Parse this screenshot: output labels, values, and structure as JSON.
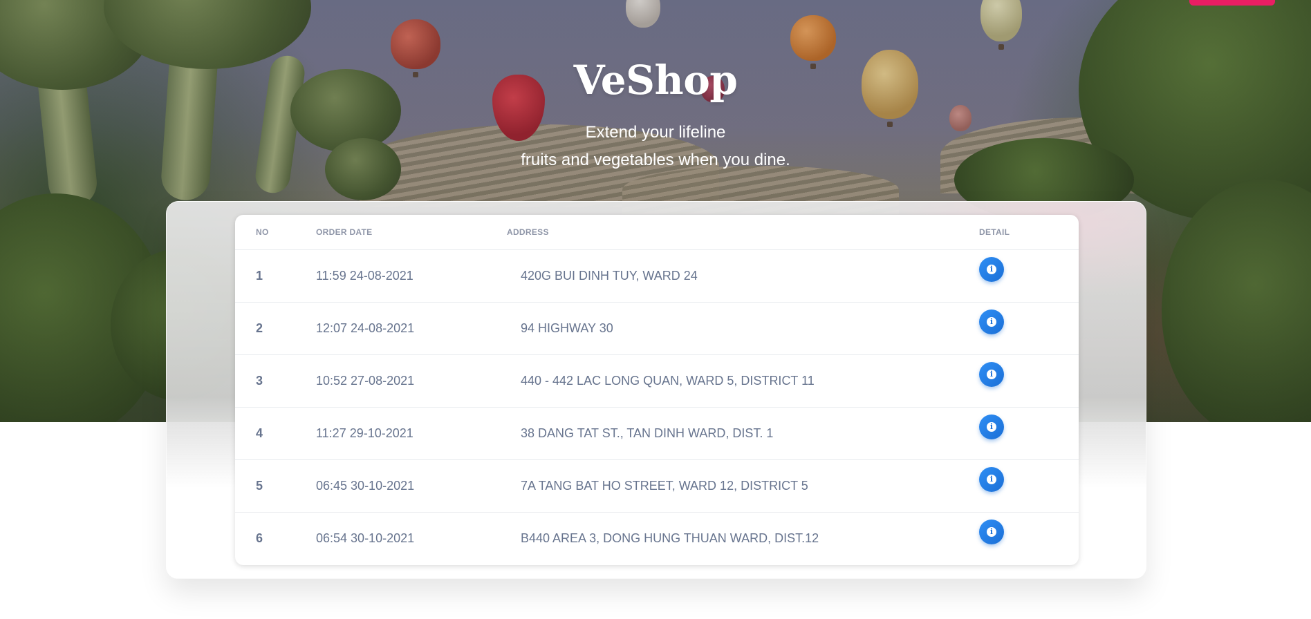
{
  "app": {
    "title": "VeShop",
    "subtitle_line1": "Extend your lifeline",
    "subtitle_line2": "fruits and vegetables when you dine."
  },
  "colors": {
    "accent": "#e91e63",
    "detail_button": "#1b6fd6",
    "table_text": "#67748e",
    "header_text": "#8f96a8"
  },
  "table": {
    "headers": {
      "no": "NO",
      "order_date": "ORDER DATE",
      "address": "ADDRESS",
      "detail": "DETAIL"
    },
    "detail_icon": "info-icon",
    "rows": [
      {
        "no": "1",
        "order_date": "11:59 24-08-2021",
        "address": "420G BUI DINH TUY, WARD 24"
      },
      {
        "no": "2",
        "order_date": "12:07 24-08-2021",
        "address": "94 HIGHWAY 30"
      },
      {
        "no": "3",
        "order_date": "10:52 27-08-2021",
        "address": "440 - 442 LAC LONG QUAN, WARD 5, DISTRICT 11"
      },
      {
        "no": "4",
        "order_date": "11:27 29-10-2021",
        "address": "38 DANG TAT ST., TAN DINH WARD, DIST. 1"
      },
      {
        "no": "5",
        "order_date": "06:45 30-10-2021",
        "address": "7A TANG BAT HO STREET, WARD 12, DISTRICT 5"
      },
      {
        "no": "6",
        "order_date": "06:54 30-10-2021",
        "address": "B440 AREA 3, DONG HUNG THUAN WARD, DIST.12"
      }
    ]
  }
}
